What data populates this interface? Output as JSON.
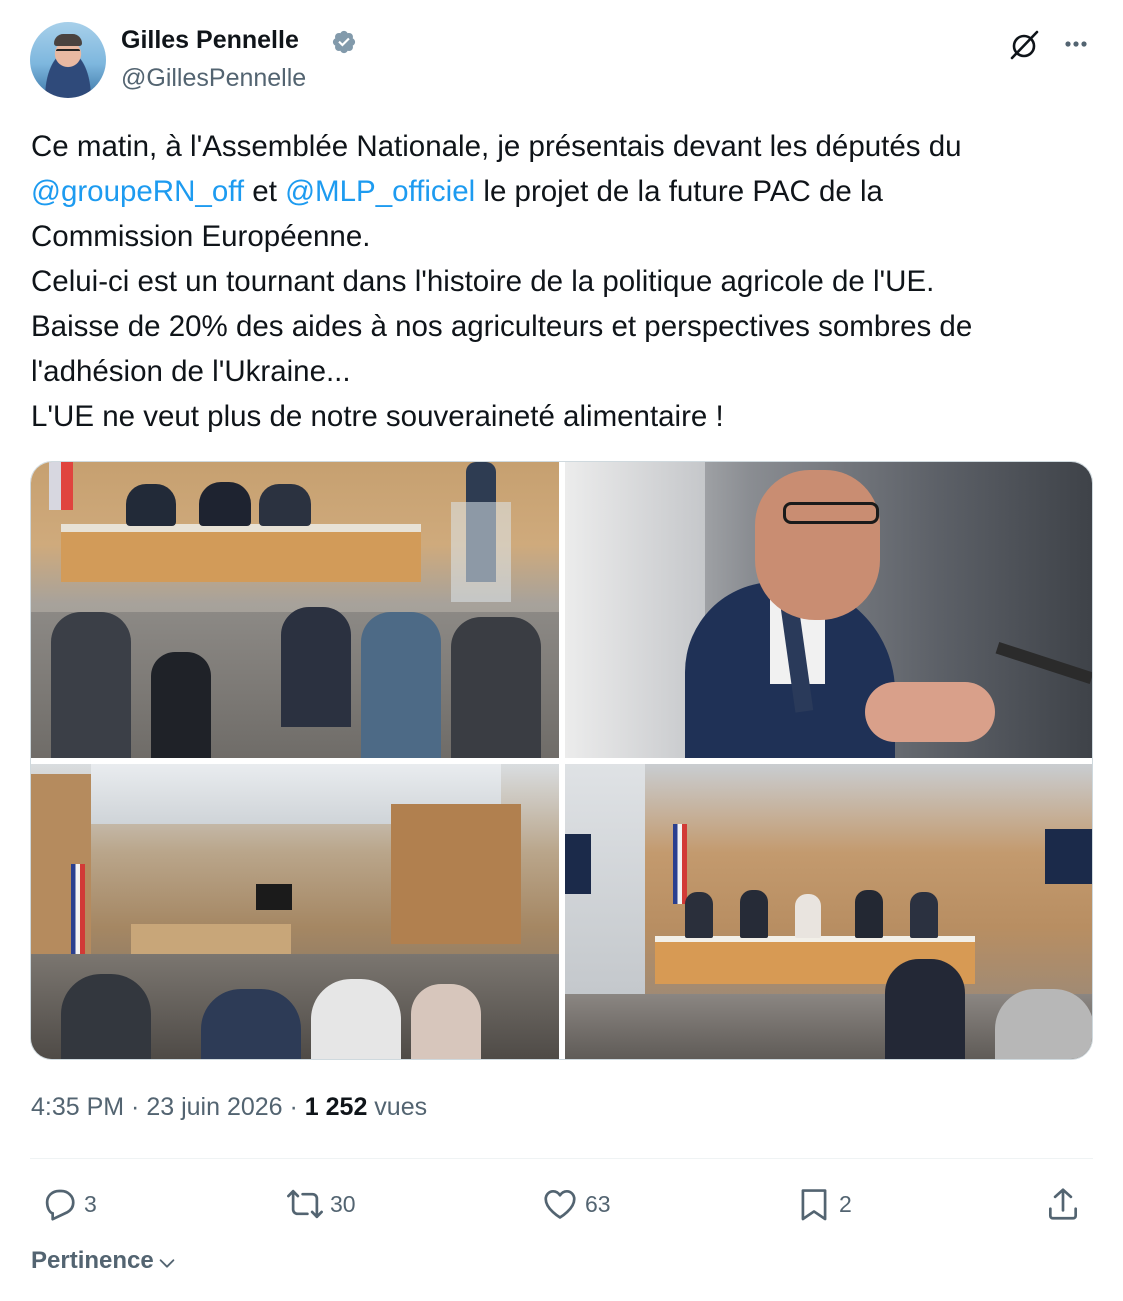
{
  "author": {
    "name": "Gilles Pennelle",
    "handle": "@GillesPennelle",
    "verified": true
  },
  "tweet": {
    "line1": "Ce matin, à l'Assemblée Nationale, je présentais devant les députés du",
    "mention1": "@groupeRN_off",
    "joiner": " et ",
    "mention2": "@MLP_officiel",
    "line2_rest": " le projet de la future PAC de la",
    "line3": "Commission Européenne.",
    "line4": "Celui-ci est un tournant dans l'histoire de la politique agricole de l'UE.",
    "line5": "Baisse de 20% des aides à nos agriculteurs et perspectives sombres de",
    "line6": "l'adhésion de l'Ukraine...",
    "line7": "L'UE ne veut plus de notre souveraineté alimentaire !"
  },
  "meta": {
    "time": "4:35 PM",
    "sep1": " · ",
    "date": "23 juin 2026",
    "sep2": " · ",
    "views_count": "1 252",
    "views_label": " vues"
  },
  "actions": {
    "replies": "3",
    "reposts": "30",
    "likes": "63",
    "bookmarks": "2"
  },
  "sort": {
    "label": "Pertinence"
  },
  "icons": {
    "header": [
      "avatar",
      "verified-badge-icon",
      "grok-icon",
      "more-icon"
    ],
    "actions": [
      "reply-icon",
      "repost-icon",
      "like-icon",
      "bookmark-icon",
      "share-icon"
    ]
  },
  "colors": {
    "link": "#1d9bf0",
    "text": "#0f1419",
    "secondary": "#536471",
    "divider": "#eff3f4"
  }
}
